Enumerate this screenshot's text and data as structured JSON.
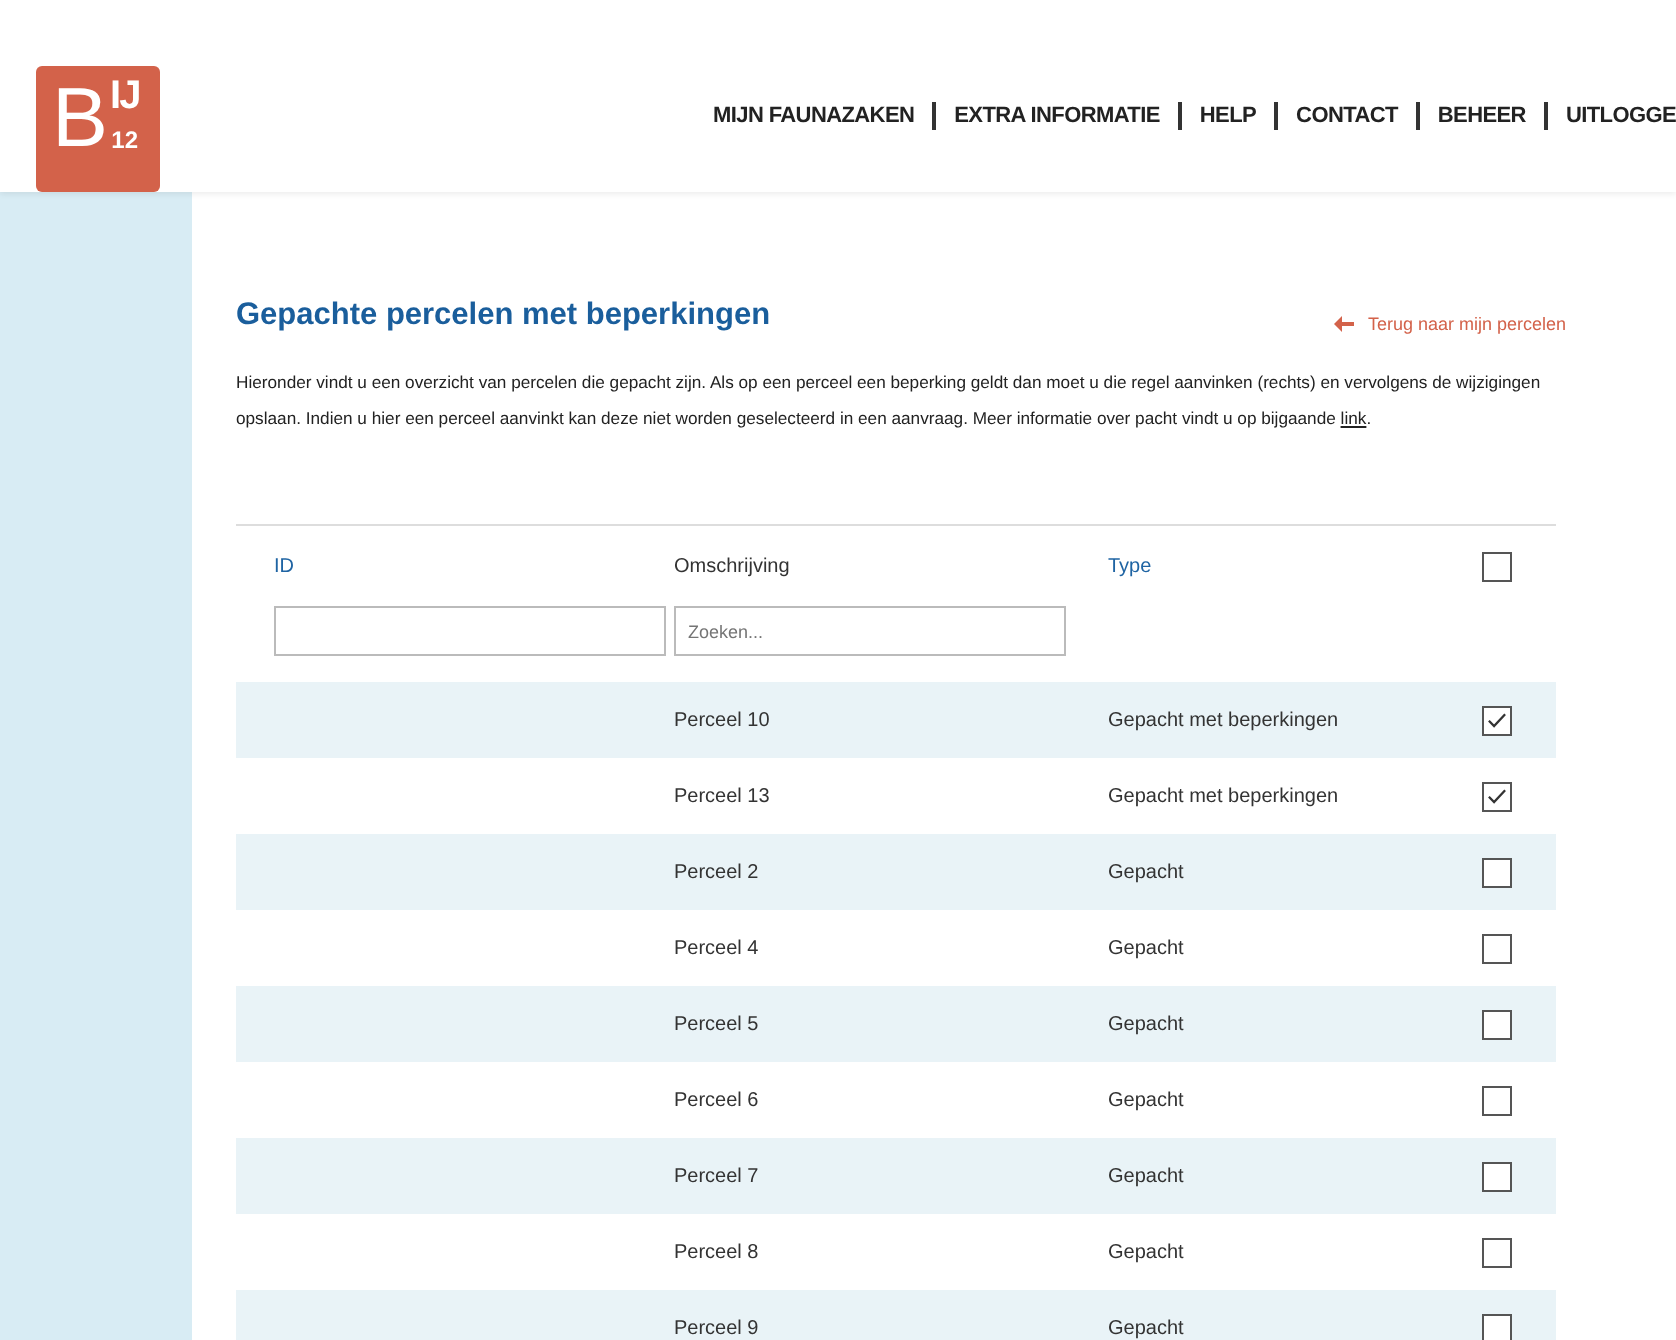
{
  "logo": {
    "letter": "B",
    "raised": "IJ",
    "lowered": "12"
  },
  "nav": [
    "MIJN FAUNAZAKEN",
    "EXTRA INFORMATIE",
    "HELP",
    "CONTACT",
    "BEHEER",
    "UITLOGGE"
  ],
  "page": {
    "title": "Gepachte percelen met beperkingen",
    "back_link": "Terug naar mijn percelen",
    "intro": {
      "text": "Hieronder vindt u een overzicht van percelen die gepacht zijn. Als op een perceel een beperking geldt dan moet u die regel aanvinken (rechts) en vervolgens de wijzigingen opslaan. Indien u hier een perceel aanvinkt kan deze niet worden geselecteerd in een aanvraag. Meer informatie over pacht vindt u op bijgaande ",
      "link": "link",
      "after": "."
    }
  },
  "table": {
    "columns": [
      {
        "label": "ID",
        "sortable": true,
        "filter": {
          "kind": "text"
        }
      },
      {
        "label": "Omschrijving",
        "sortable": false,
        "filter": {
          "kind": "text",
          "placeholder": "Zoeken..."
        }
      },
      {
        "label": "Type",
        "sortable": true
      }
    ],
    "select_all": {
      "checked": false
    },
    "rows": [
      {
        "description": "Perceel 10",
        "type": "Gepacht met beperkingen",
        "checked": true
      },
      {
        "description": "Perceel 13",
        "type": "Gepacht met beperkingen",
        "checked": true
      },
      {
        "description": "Perceel 2",
        "type": "Gepacht",
        "checked": false
      },
      {
        "description": "Perceel 4",
        "type": "Gepacht",
        "checked": false
      },
      {
        "description": "Perceel 5",
        "type": "Gepacht",
        "checked": false
      },
      {
        "description": "Perceel 6",
        "type": "Gepacht",
        "checked": false
      },
      {
        "description": "Perceel 7",
        "type": "Gepacht",
        "checked": false
      },
      {
        "description": "Perceel 8",
        "type": "Gepacht",
        "checked": false
      },
      {
        "description": "Perceel 9",
        "type": "Gepacht",
        "checked": false
      }
    ]
  }
}
